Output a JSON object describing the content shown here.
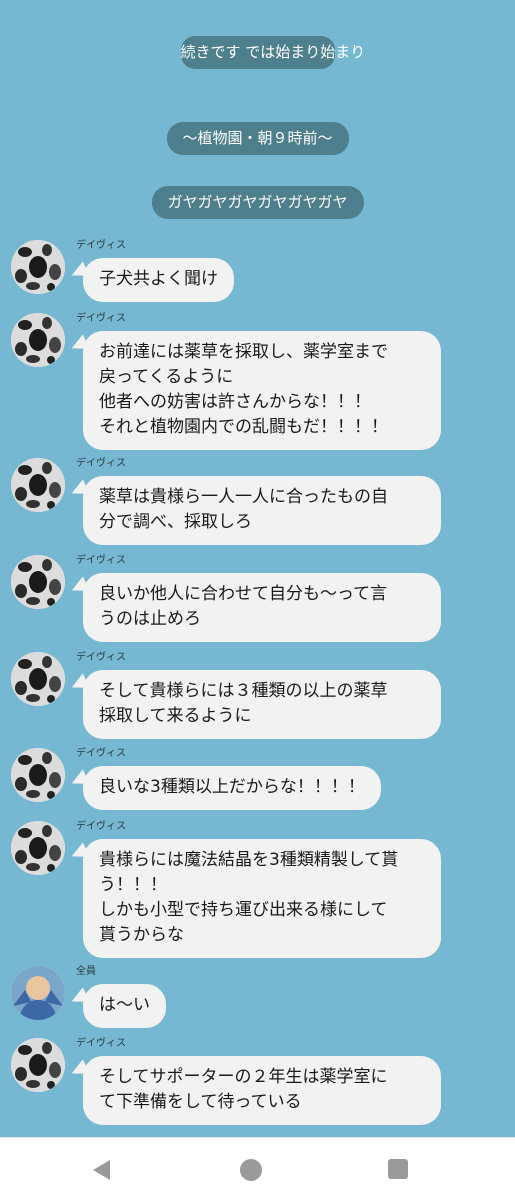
{
  "system_messages": [
    "続きです\nでは始まり始まり",
    "〜植物園・朝９時前〜",
    "ガヤガヤガヤガヤガヤガヤ"
  ],
  "messages": [
    {
      "sender": "デイヴィス",
      "avatar": "dalmatian",
      "text": "子犬共よく聞け"
    },
    {
      "sender": "デイヴィス",
      "avatar": "dalmatian",
      "text": "お前達には薬草を採取し、薬学室まで\n戻ってくるように\n他者への妨害は許さんからな！！！\nそれと植物園内での乱闘もだ！！！！"
    },
    {
      "sender": "デイヴィス",
      "avatar": "dalmatian",
      "text": "薬草は貴様ら一人一人に合ったもの自\n分で調べ、採取しろ"
    },
    {
      "sender": "デイヴィス",
      "avatar": "dalmatian",
      "text": "良いか他人に合わせて自分も〜って言\nうのは止めろ"
    },
    {
      "sender": "デイヴィス",
      "avatar": "dalmatian",
      "text": "そして貴様らには３種類の以上の薬草\n採取して来るように"
    },
    {
      "sender": "デイヴィス",
      "avatar": "dalmatian",
      "text": "良いな3種類以上だからな！！！！"
    },
    {
      "sender": "デイヴィス",
      "avatar": "dalmatian",
      "text": "貴様らには魔法結晶を3種類精製して貰\nう！！！\nしかも小型で持ち運び出来る様にして\n貰うからな"
    },
    {
      "sender": "全員",
      "avatar": "group",
      "text": "は〜い"
    },
    {
      "sender": "デイヴィス",
      "avatar": "dalmatian",
      "text": "そしてサポーターの２年生は薬学室に\nて下準備をして待っている"
    }
  ],
  "navbar": {
    "back": "back-triangle",
    "home": "home-circle",
    "recents": "recents-square"
  },
  "colors": {
    "background": "#76b8d1",
    "system_bubble": "#4e7f8c",
    "bubble": "#f2f2f2"
  }
}
